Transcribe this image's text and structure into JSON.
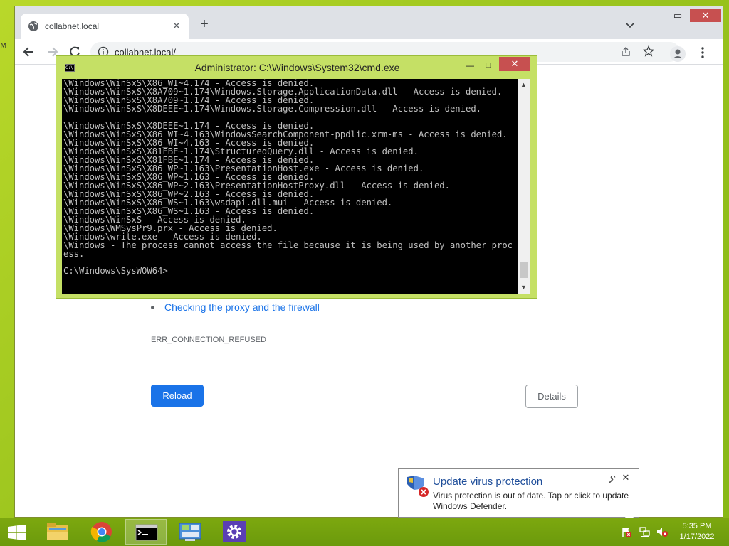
{
  "desktop": {
    "edge_glyph": "M"
  },
  "browser": {
    "tab": {
      "title": "collabnet.local",
      "icon": "globe-icon",
      "close_glyph": "✕"
    },
    "new_tab_glyph": "+",
    "window_controls": {
      "minimize": "—",
      "maximize": "▭",
      "close": "✕"
    },
    "address": {
      "url": "collabnet.local/"
    },
    "page": {
      "suggestions": [
        "Checking the proxy and the firewall"
      ],
      "error_code": "ERR_CONNECTION_REFUSED",
      "reload_label": "Reload",
      "details_label": "Details"
    }
  },
  "cmd": {
    "title": "Administrator: C:\\Windows\\System32\\cmd.exe",
    "icon_text": "C:\\",
    "controls": {
      "minimize": "—",
      "maximize": "□",
      "close": "✕"
    },
    "output": "\\Windows\\WinSxS\\X86_WI~4.174 - Access is denied.\n\\Windows\\WinSxS\\X8A709~1.174\\Windows.Storage.ApplicationData.dll - Access is denied.\n\\Windows\\WinSxS\\X8A709~1.174 - Access is denied.\n\\Windows\\WinSxS\\X8DEEE~1.174\\Windows.Storage.Compression.dll - Access is denied.\n\n\\Windows\\WinSxS\\X8DEEE~1.174 - Access is denied.\n\\Windows\\WinSxS\\X86_WI~4.163\\WindowsSearchComponent-ppdlic.xrm-ms - Access is denied.\n\\Windows\\WinSxS\\X86_WI~4.163 - Access is denied.\n\\Windows\\WinSxS\\X81FBE~1.174\\StructuredQuery.dll - Access is denied.\n\\Windows\\WinSxS\\X81FBE~1.174 - Access is denied.\n\\Windows\\WinSxS\\X86_WP~1.163\\PresentationHost.exe - Access is denied.\n\\Windows\\WinSxS\\X86_WP~1.163 - Access is denied.\n\\Windows\\WinSxS\\X86_WP~2.163\\PresentationHostProxy.dll - Access is denied.\n\\Windows\\WinSxS\\X86_WP~2.163 - Access is denied.\n\\Windows\\WinSxS\\X86_WS~1.163\\wsdapi.dll.mui - Access is denied.\n\\Windows\\WinSxS\\X86_WS~1.163 - Access is denied.\n\\Windows\\WinSxS - Access is denied.\n\\Windows\\WMSysPr9.prx - Access is denied.\n\\Windows\\write.exe - Access is denied.\n\\Windows - The process cannot access the file because it is being used by another process.\n\nC:\\Windows\\SysWOW64>"
  },
  "notification": {
    "title": "Update virus protection",
    "body": "Virus protection is out of date. Tap or click to update Windows Defender.",
    "close_glyph": "✕",
    "icon": "defender-shield-error-icon"
  },
  "taskbar": {
    "items": [
      {
        "name": "file-explorer",
        "icon": "folder-icon"
      },
      {
        "name": "chrome",
        "icon": "chrome-icon"
      },
      {
        "name": "command-prompt",
        "icon": "cmd-icon",
        "active": true
      },
      {
        "name": "control-panel",
        "icon": "control-panel-icon"
      },
      {
        "name": "settings",
        "icon": "gear-icon"
      }
    ],
    "clock": {
      "time": "5:35 PM",
      "date": "1/17/2022"
    }
  },
  "colors": {
    "desktop": "#9cc51e",
    "cmd_frame": "#c5e065",
    "close_red": "#c75050",
    "link_blue": "#1a73e8",
    "notif_title": "#1f4e9a"
  }
}
